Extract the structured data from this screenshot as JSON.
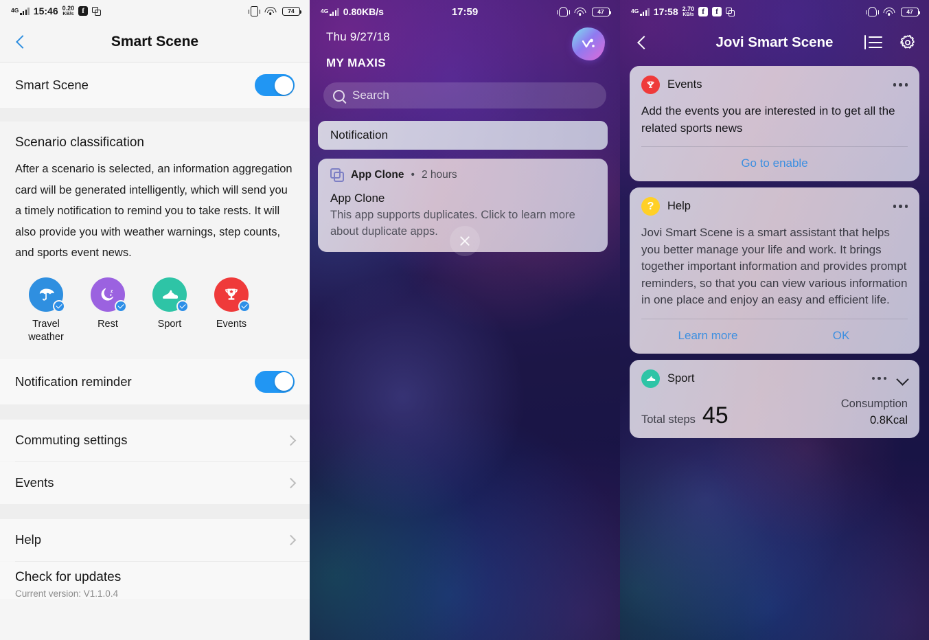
{
  "settings_panel": {
    "status_bar": {
      "network": "4G",
      "time": "15:46",
      "speed_value": "0.20",
      "speed_unit": "KB/s",
      "apps": [
        "facebook-icon",
        "app-clone-icon"
      ],
      "vibrate": "vibrate-icon",
      "wifi": "wifi-icon",
      "battery": "74"
    },
    "nav": {
      "back": "back-chevron",
      "title": "Smart Scene"
    },
    "master_toggle": {
      "label": "Smart Scene",
      "state": "on"
    },
    "section": {
      "title": "Scenario classification",
      "body": "After a scenario is selected, an information aggregation card will be generated intelligently, which will send you a timely notification to remind you to take rests. It will also provide you with weather warnings, step counts, and sports event news."
    },
    "scenarios": [
      {
        "label": "Travel weather",
        "icon": "umbrella-icon",
        "color": "#2f8fe0",
        "checked": true
      },
      {
        "label": "Rest",
        "icon": "moon-sleep-icon",
        "color": "#9b62e0",
        "checked": true
      },
      {
        "label": "Sport",
        "icon": "shoe-icon",
        "color": "#2ec4a6",
        "checked": true
      },
      {
        "label": "Events",
        "icon": "trophy-icon",
        "color": "#ef3a3a",
        "checked": true
      }
    ],
    "notification_reminder": {
      "label": "Notification reminder",
      "state": "on"
    },
    "links": [
      {
        "label": "Commuting settings"
      },
      {
        "label": "Events"
      }
    ],
    "help_link": {
      "label": "Help"
    },
    "updates": {
      "label": "Check for updates",
      "sub": "Current version: V1.1.0.4"
    }
  },
  "shade_panel": {
    "status_bar": {
      "network": "4G",
      "speed": "0.80KB/s",
      "time": "17:59",
      "mute": "bell-muted-icon",
      "wifi": "wifi-icon",
      "battery": "47"
    },
    "date": "Thu 9/27/18",
    "carrier": "MY MAXIS",
    "assistant_icon": "jovi-blob-icon",
    "search": {
      "placeholder": "Search",
      "icon": "search-icon"
    },
    "group_header": "Notification",
    "notification": {
      "app": "App Clone",
      "separator": "•",
      "time": "2 hours",
      "title": "App Clone",
      "body": "This app supports duplicates. Click to learn more about duplicate apps.",
      "app_icon": "app-clone-icon"
    },
    "close_button": "close-icon"
  },
  "jovi_panel": {
    "status_bar": {
      "network": "4G",
      "time": "17:58",
      "speed_value": "2.70",
      "speed_unit": "KB/s",
      "apps": [
        "facebook-icon",
        "facebook-icon",
        "app-clone-icon"
      ],
      "mute": "bell-muted-icon",
      "wifi": "wifi-icon",
      "battery": "47"
    },
    "nav": {
      "back": "back-chevron",
      "title": "Jovi Smart Scene",
      "list_icon": "list-icon",
      "settings_icon": "gear-icon"
    },
    "cards": [
      {
        "name": "Events",
        "icon": "trophy-icon",
        "badge_color": "#ef3a3a",
        "menu": "more-options-icon",
        "text": "Add the events you are interested in to get all the related sports news",
        "actions": [
          "Go to enable"
        ]
      },
      {
        "name": "Help",
        "icon": "question-icon",
        "badge_color": "#ffd027",
        "menu": "more-options-icon",
        "text": "Jovi Smart Scene is a smart assistant that helps you better manage your life and work. It brings together important information and provides prompt reminders, so that you can view various information in one place and enjoy an easy and efficient life.",
        "actions": [
          "Learn more",
          "OK"
        ]
      },
      {
        "name": "Sport",
        "icon": "shoe-icon",
        "badge_color": "#2ec4a6",
        "menu": "more-options-icon",
        "collapse": "chevron-down-icon",
        "steps_label": "Total steps",
        "steps_value": "45",
        "consumption_label": "Consumption",
        "consumption_value": "0.8Kcal"
      }
    ]
  }
}
